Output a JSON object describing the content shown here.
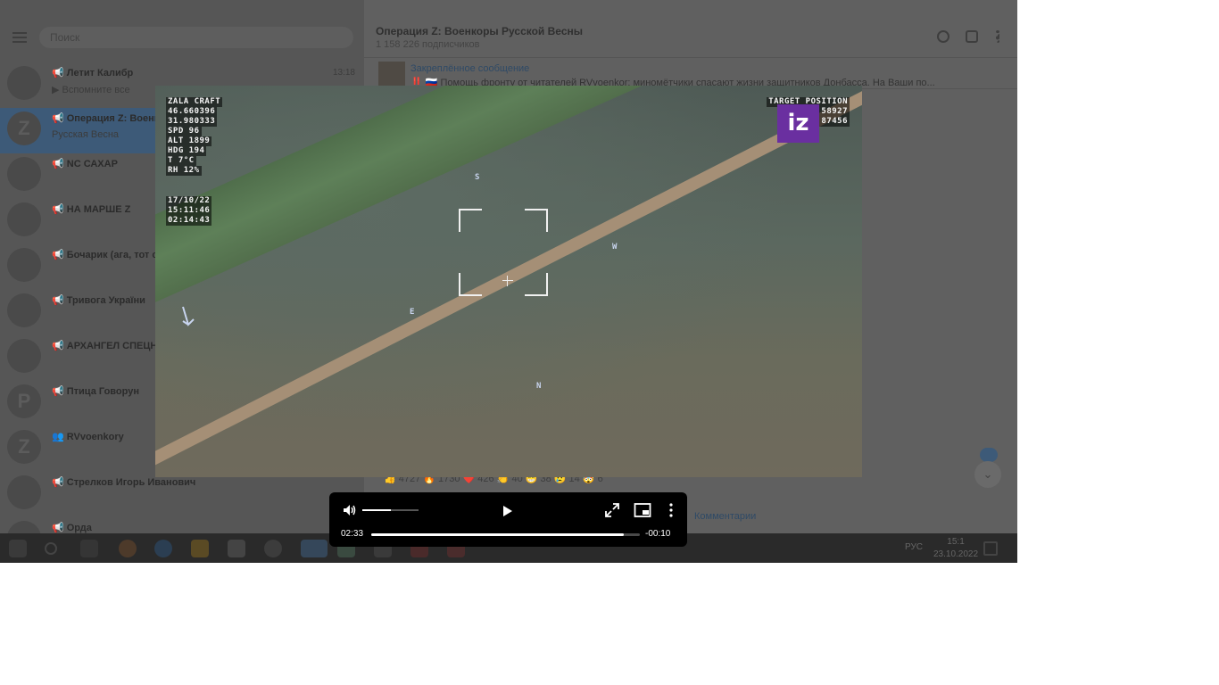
{
  "sidebar": {
    "search_placeholder": "Поиск",
    "chats": [
      {
        "name": "📢 Летит Калибр",
        "preview": "▶ Вспомните все",
        "time": "13:18",
        "avatar": ""
      },
      {
        "name": "📢 Операция Z: Военкоры",
        "preview": "Русская Весна",
        "time": "",
        "avatar": "Z"
      },
      {
        "name": "📢 NC САХАР",
        "preview": "",
        "time": "",
        "avatar": ""
      },
      {
        "name": "📢 НА МАРШЕ Z",
        "preview": "",
        "time": "",
        "avatar": ""
      },
      {
        "name": "📢 Бочарик (ага, тот с",
        "preview": "",
        "time": "",
        "avatar": ""
      },
      {
        "name": "📢 Тривога України",
        "preview": "",
        "time": "",
        "avatar": ""
      },
      {
        "name": "📢 АРХАНГЕЛ СПЕЦНА",
        "preview": "",
        "time": "",
        "avatar": ""
      },
      {
        "name": "📢 Птица Говорун",
        "preview": "",
        "time": "",
        "avatar": "P"
      },
      {
        "name": "👥 RVvoenkory",
        "preview": "",
        "time": "",
        "avatar": "Z"
      },
      {
        "name": "📢 Стрелков Игорь Иванович",
        "preview": "",
        "time": "",
        "avatar": ""
      },
      {
        "name": "📢 Орда",
        "preview": "",
        "time": "",
        "avatar": ""
      }
    ]
  },
  "channel": {
    "title": "Операция Z: Военкоры Русской Весны",
    "subscribers": "1 158 226 подписчиков",
    "pinned_label": "Закреплённое сообщение",
    "pinned_text": "‼️ 🇷🇺 Помощь фронту от читателей RVvoenkor: миномётчики спасают жизни защитников Донбасса. На Ваши по...",
    "reactions": "👍 4727   🔥 1730   ❤️ 426   👏 40   😁 38   😢 14   🤯 6",
    "comments_label": "Комментарии"
  },
  "taskbar": {
    "language": "РУС",
    "time": "15:1",
    "date": "23.10.2022"
  },
  "video": {
    "osd_left": [
      "ZALA CRAFT",
      "46.660396",
      "31.980333",
      "SPD 96",
      "ALT 1899",
      "HDG 194",
      "T 7°C",
      "RH 12%"
    ],
    "osd_time": [
      "17/10/22",
      "15:11:46",
      "02:14:43"
    ],
    "osd_right": [
      "TARGET POSITION",
      "58927",
      "87456"
    ],
    "logo_text": "iz",
    "compass": {
      "s": "S",
      "e": "E",
      "n": "N",
      "w": "W",
      "arrow": "N"
    }
  },
  "controls": {
    "time_current": "02:33",
    "time_remaining": "-00:10",
    "progress_fraction": 0.94,
    "volume_fraction": 0.5
  }
}
